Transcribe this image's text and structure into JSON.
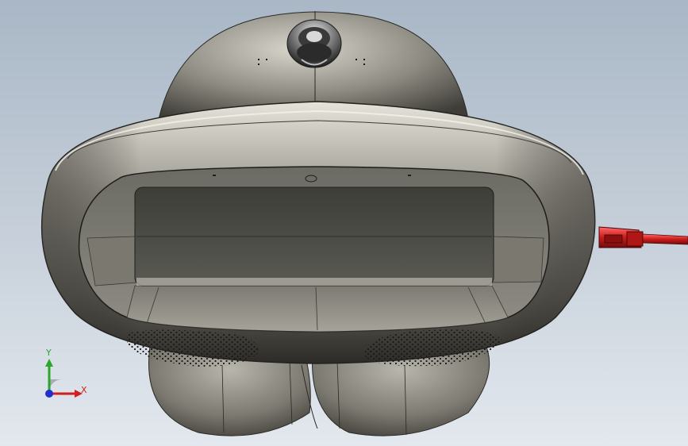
{
  "viewport": {
    "background_top": "#a9b7c6",
    "background_bottom": "#e3e8ee"
  },
  "model": {
    "shell_color": "#8e8b82",
    "shell_shadow": "#3f3d38",
    "cavity_color": "#4a4a44",
    "cable_color": "#cc1b1b",
    "components": [
      "top-dome",
      "camera-lens",
      "outer-ring",
      "inner-cavity",
      "left-speaker-grille",
      "right-speaker-grille",
      "bottom-lobes",
      "usb-cable"
    ]
  },
  "triad": {
    "y_label": "Y",
    "x_label": "X",
    "y_color": "#2ba52b",
    "x_color": "#d02020",
    "z_color": "#2030d0"
  }
}
